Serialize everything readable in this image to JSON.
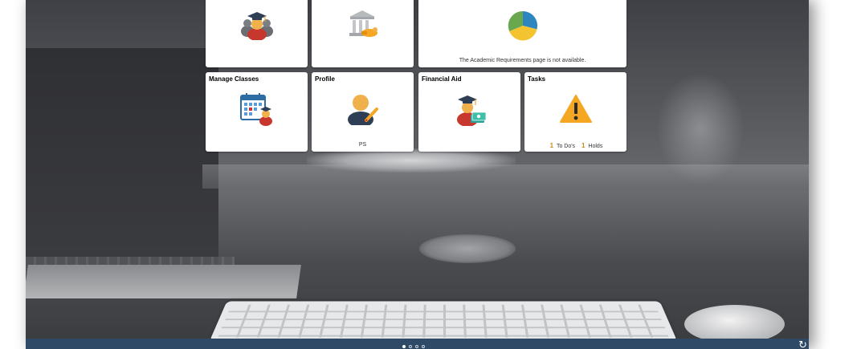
{
  "tiles": {
    "academic_records": {
      "title": ""
    },
    "financial_account": {
      "title": ""
    },
    "academic_requirements": {
      "title": "",
      "message": "The Academic Requirements page is not available."
    },
    "manage_classes": {
      "title": "Manage Classes"
    },
    "profile": {
      "title": "Profile",
      "footer": "PS"
    },
    "financial_aid": {
      "title": "Financial Aid"
    },
    "tasks": {
      "title": "Tasks",
      "todo_count": "1",
      "todo_label": "To Do's",
      "holds_count": "1",
      "holds_label": "Holds"
    }
  },
  "pager": {
    "pages": 4,
    "active": 0
  },
  "icons": {
    "academic_records": "graduates-icon",
    "financial_account": "bank-payment-icon",
    "academic_requirements": "pie-chart-icon",
    "manage_classes": "calendar-graduate-icon",
    "profile": "user-edit-icon",
    "financial_aid": "graduate-money-icon",
    "tasks": "warning-icon",
    "refresh": "refresh-icon"
  },
  "colors": {
    "bottom_bar": "#2f4a66",
    "accent_orange": "#f5a623",
    "holds_number": "#c8851a"
  }
}
